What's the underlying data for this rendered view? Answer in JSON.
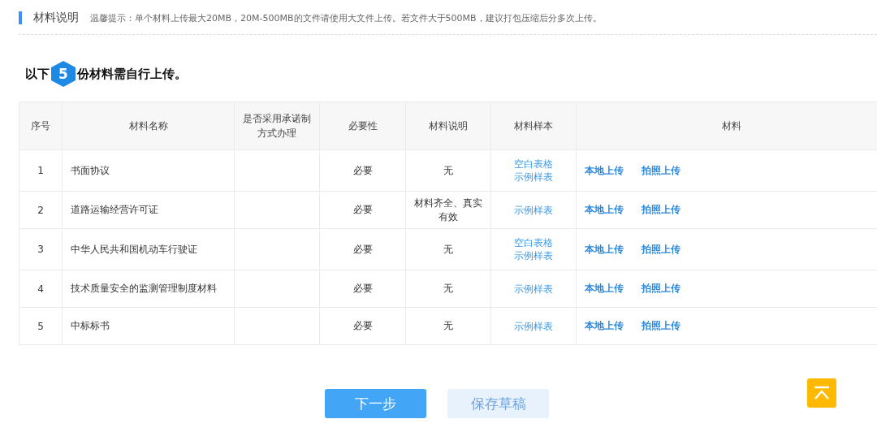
{
  "section": {
    "title": "材料说明",
    "hint": "温馨提示：单个材料上传最大20MB，20M-500MB的文件请使用大文件上传。若文件大于500MB，建议打包压缩后分多次上传。"
  },
  "heading": {
    "prefix": "以下",
    "count": "5",
    "suffix": "份材料需自行上传。"
  },
  "table": {
    "columns": [
      "序号",
      "材料名称",
      "是否采用承诺制方式办理",
      "必要性",
      "材料说明",
      "材料样本",
      "材料"
    ],
    "rows": [
      {
        "no": "1",
        "name": "书面协议",
        "necessity": "必要",
        "note": "无",
        "samples": [
          "空白表格",
          "示例样表"
        ],
        "actions": [
          "本地上传",
          "拍照上传"
        ]
      },
      {
        "no": "2",
        "name": "道路运输经营许可证",
        "necessity": "必要",
        "note": "材料齐全、真实有效",
        "samples": [
          "示例样表"
        ],
        "actions": [
          "本地上传",
          "拍照上传"
        ]
      },
      {
        "no": "3",
        "name": "中华人民共和国机动车行驶证",
        "necessity": "必要",
        "note": "无",
        "samples": [
          "空白表格",
          "示例样表"
        ],
        "actions": [
          "本地上传",
          "拍照上传"
        ]
      },
      {
        "no": "4",
        "name": "技术质量安全的监测管理制度材料",
        "necessity": "必要",
        "note": "无",
        "samples": [
          "示例样表"
        ],
        "actions": [
          "本地上传",
          "拍照上传"
        ]
      },
      {
        "no": "5",
        "name": "中标标书",
        "necessity": "必要",
        "note": "无",
        "samples": [
          "示例样表"
        ],
        "actions": [
          "本地上传",
          "拍照上传"
        ]
      }
    ]
  },
  "buttons": [
    {
      "label": "下一步",
      "kind": "primary"
    },
    {
      "label": "保存草稿",
      "kind": "secondary"
    }
  ]
}
